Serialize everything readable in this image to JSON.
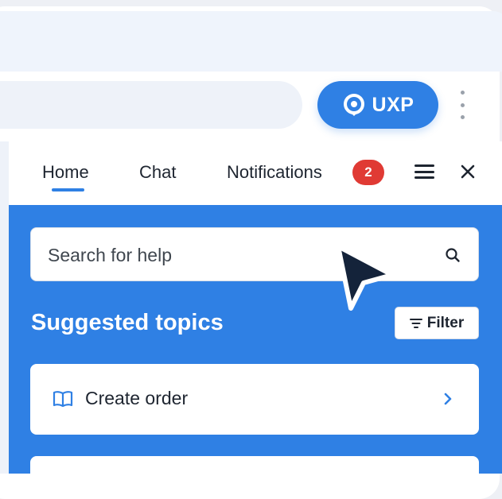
{
  "extension": {
    "label": "UXP",
    "icon": "location-pin-icon"
  },
  "tabs": [
    {
      "label": "Home",
      "active": true
    },
    {
      "label": "Chat"
    },
    {
      "label": "Notifications",
      "badge": "2"
    }
  ],
  "search": {
    "placeholder": "Search for help"
  },
  "suggested": {
    "title": "Suggested topics",
    "filter_label": "Filter"
  },
  "topics": [
    {
      "label": "Create order",
      "icon": "book-icon"
    }
  ],
  "colors": {
    "accent": "#2f80e4",
    "badge": "#e03a34",
    "text": "#1e2530"
  }
}
